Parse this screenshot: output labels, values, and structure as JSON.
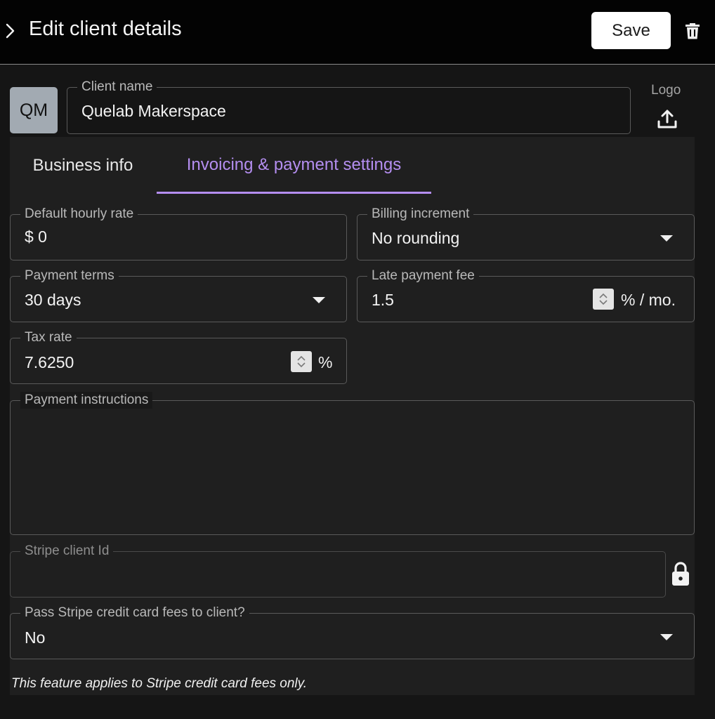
{
  "header": {
    "title": "Edit client details",
    "save_label": "Save",
    "collapse_icon": "chevron-right-icon",
    "delete_icon": "trash-icon"
  },
  "client": {
    "avatar_initials": "QM",
    "name_label": "Client name",
    "name_value": "Quelab Makerspace",
    "logo_label": "Logo",
    "upload_icon": "upload-icon"
  },
  "tabs": [
    {
      "label": "Business info",
      "active": false
    },
    {
      "label": "Invoicing & payment settings",
      "active": true
    }
  ],
  "form": {
    "hourly_rate": {
      "label": "Default hourly rate",
      "value": "$ 0"
    },
    "billing_increment": {
      "label": "Billing increment",
      "value": "No rounding"
    },
    "payment_terms": {
      "label": "Payment terms",
      "value": "30 days"
    },
    "late_fee": {
      "label": "Late payment fee",
      "value": "1.5",
      "unit": "% / mo."
    },
    "tax_rate": {
      "label": "Tax rate",
      "value": "7.6250",
      "unit": "%"
    },
    "payment_instructions": {
      "label": "Payment instructions",
      "value": ""
    },
    "stripe_client_id": {
      "label": "Stripe client Id",
      "value": "",
      "icon": "lock-icon"
    },
    "pass_fees": {
      "label": "Pass Stripe credit card fees to client?",
      "value": "No"
    },
    "helper_text": "This feature applies to Stripe credit card fees only."
  },
  "colors": {
    "accent": "#b48ef0",
    "header_bg": "#030303",
    "panel_bg": "#1f1f1f",
    "avatar_bg": "#a2aab2"
  }
}
